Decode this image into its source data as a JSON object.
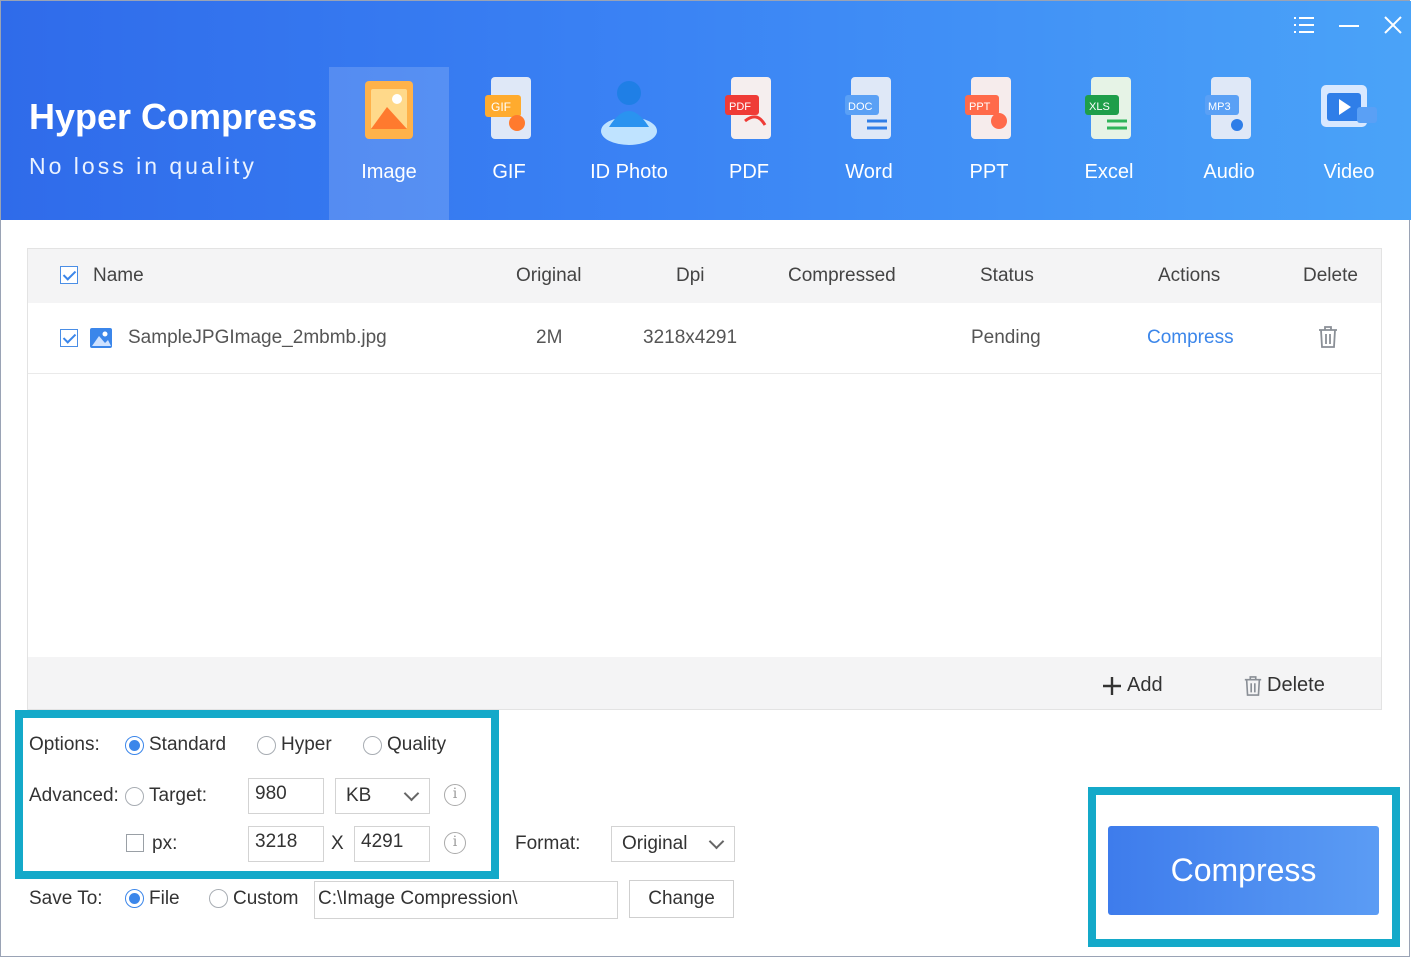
{
  "app": {
    "title": "Hyper Compress",
    "subtitle": "No loss in quality"
  },
  "tabs": [
    {
      "label": "Image",
      "icon": "image-icon",
      "active": true
    },
    {
      "label": "GIF",
      "icon": "gif-icon"
    },
    {
      "label": "ID Photo",
      "icon": "id-photo-icon"
    },
    {
      "label": "PDF",
      "icon": "pdf-icon"
    },
    {
      "label": "Word",
      "icon": "word-icon"
    },
    {
      "label": "PPT",
      "icon": "ppt-icon"
    },
    {
      "label": "Excel",
      "icon": "excel-icon"
    },
    {
      "label": "Audio",
      "icon": "audio-icon"
    },
    {
      "label": "Video",
      "icon": "video-icon"
    }
  ],
  "table": {
    "columns": {
      "name": "Name",
      "original": "Original",
      "dpi": "Dpi",
      "compressed": "Compressed",
      "status": "Status",
      "actions": "Actions",
      "delete": "Delete"
    },
    "rows": [
      {
        "name": "SampleJPGImage_2mbmb.jpg",
        "original": "2M",
        "dpi": "3218x4291",
        "compressed": "",
        "status": "Pending",
        "action": "Compress",
        "checked": true
      }
    ],
    "footer": {
      "add": "Add",
      "delete": "Delete"
    }
  },
  "options": {
    "label": "Options:",
    "modes": [
      "Standard",
      "Hyper",
      "Quality"
    ],
    "selected": "Standard",
    "advanced_label": "Advanced:",
    "target_label": "Target:",
    "target_value": "980",
    "target_unit": "KB",
    "px_label": "px:",
    "px_width": "3218",
    "px_x": "X",
    "px_height": "4291",
    "format_label": "Format:",
    "format_value": "Original"
  },
  "save": {
    "label": "Save To:",
    "file": "File",
    "custom": "Custom",
    "path": "C:\\Image Compression\\",
    "change": "Change"
  },
  "compress_button": "Compress",
  "colors": {
    "accent": "#3b86ea",
    "header_start": "#2f6bea",
    "header_end": "#4aa3f8",
    "highlight": "#14a9c9"
  }
}
